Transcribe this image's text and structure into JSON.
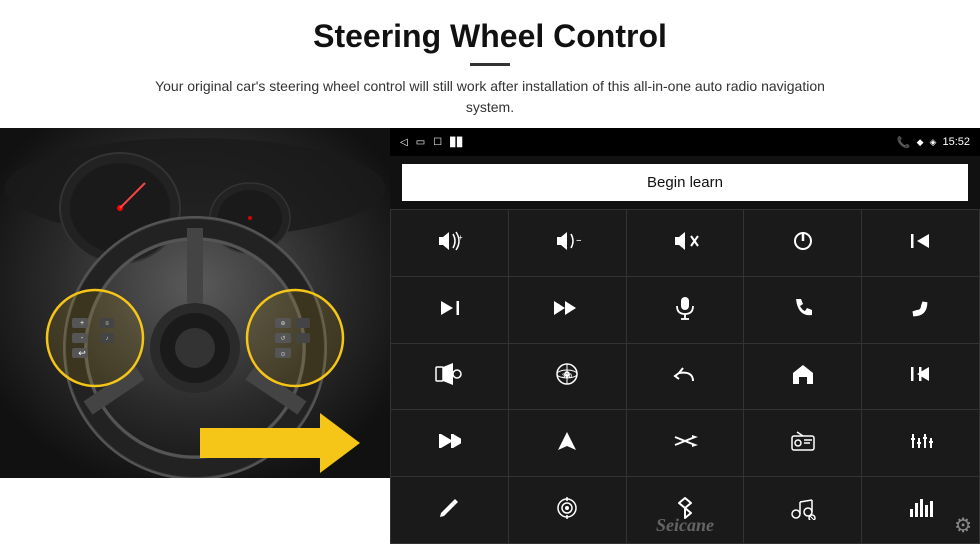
{
  "header": {
    "title": "Steering Wheel Control",
    "subtitle": "Your original car's steering wheel control will still work after installation of this all-in-one auto radio navigation system."
  },
  "status_bar": {
    "time": "15:52",
    "back_icon": "◁",
    "home_icon": "▭",
    "recent_icon": "☐",
    "signal_icon": "▊▊",
    "wifi_icon": "◈",
    "phone_icon": "📞",
    "location_icon": "◆"
  },
  "controls": {
    "begin_learn_label": "Begin learn",
    "buttons": [
      {
        "icon": "🔊+",
        "name": "vol-up"
      },
      {
        "icon": "🔊-",
        "name": "vol-down"
      },
      {
        "icon": "🔇",
        "name": "mute"
      },
      {
        "icon": "⏻",
        "name": "power"
      },
      {
        "icon": "⏮",
        "name": "prev-track"
      },
      {
        "icon": "⏭",
        "name": "next-track"
      },
      {
        "icon": "⏭⏭",
        "name": "fast-forward"
      },
      {
        "icon": "🎙",
        "name": "mic"
      },
      {
        "icon": "📞",
        "name": "call"
      },
      {
        "icon": "📵",
        "name": "end-call"
      },
      {
        "icon": "📢",
        "name": "speaker"
      },
      {
        "icon": "🔄",
        "name": "360-view"
      },
      {
        "icon": "↩",
        "name": "back"
      },
      {
        "icon": "🏠",
        "name": "home"
      },
      {
        "icon": "⏮⏮",
        "name": "rewind"
      },
      {
        "icon": "⏭",
        "name": "skip-next"
      },
      {
        "icon": "▶",
        "name": "play"
      },
      {
        "icon": "⇌",
        "name": "shuffle"
      },
      {
        "icon": "📻",
        "name": "radio"
      },
      {
        "icon": "⚙",
        "name": "eq"
      },
      {
        "icon": "✏",
        "name": "edit"
      },
      {
        "icon": "⊙",
        "name": "target"
      },
      {
        "icon": "✱",
        "name": "bluetooth"
      },
      {
        "icon": "🎵",
        "name": "music"
      },
      {
        "icon": "📊",
        "name": "equalizer"
      }
    ]
  },
  "watermark": "Seicane",
  "gear_icon": "⚙"
}
